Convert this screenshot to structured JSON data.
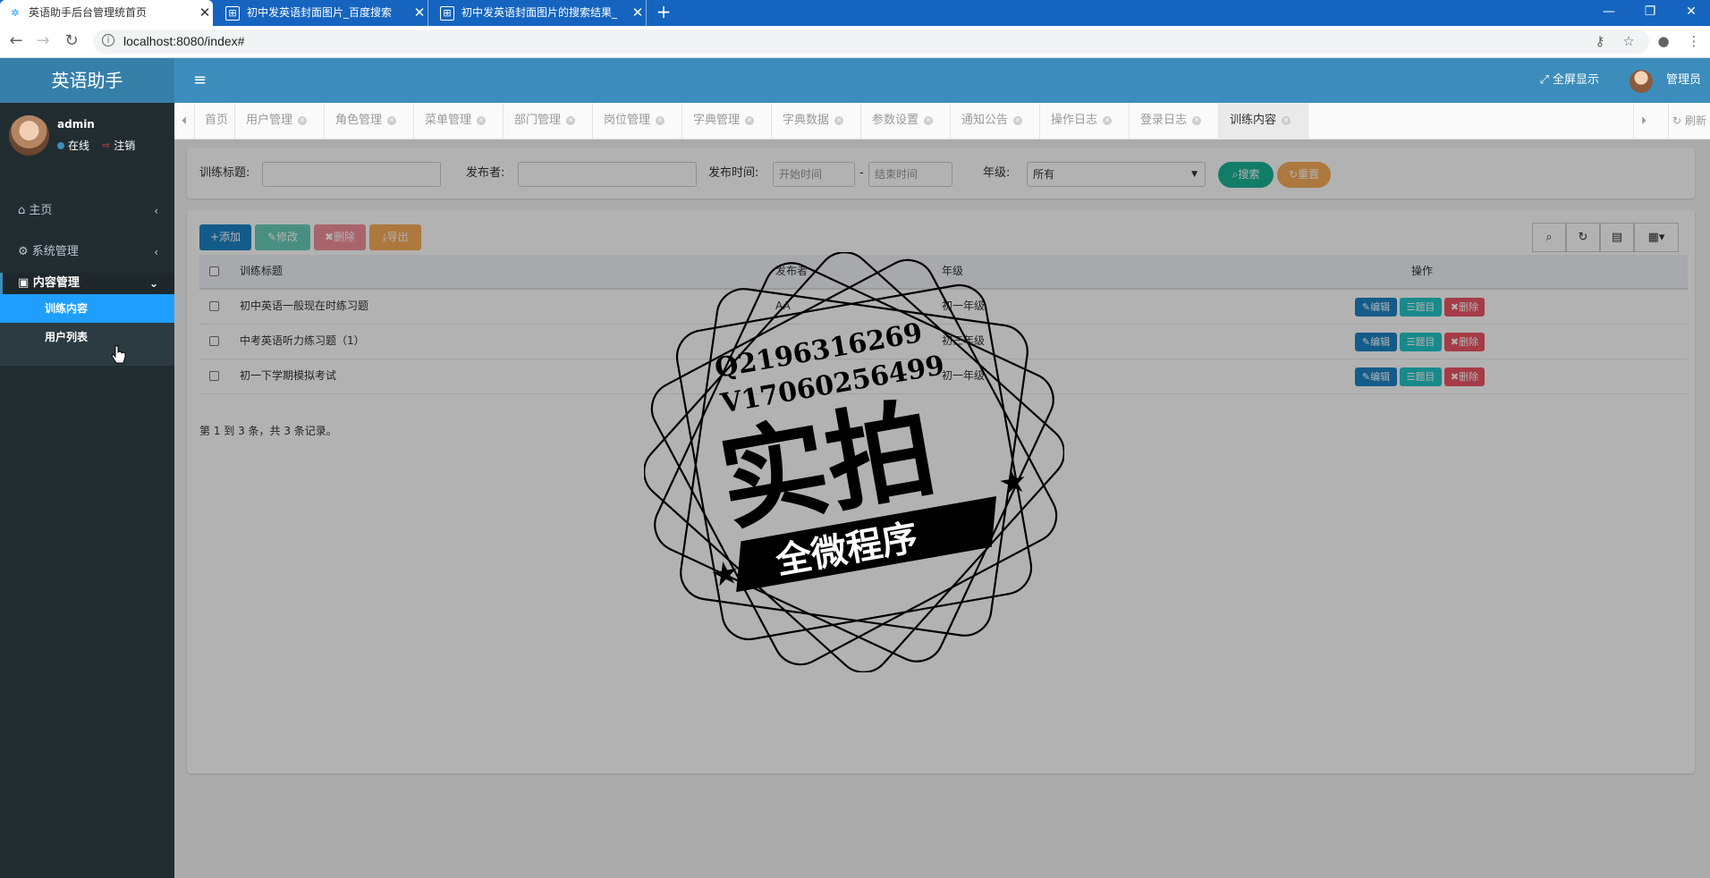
{
  "browser": {
    "tabs": [
      {
        "title": "英语助手后台管理统首页",
        "active": true
      },
      {
        "title": "初中发英语封面图片_百度搜索",
        "active": false
      },
      {
        "title": "初中发英语封面图片的搜索结果_",
        "active": false
      }
    ],
    "url": "localhost:8080/index#"
  },
  "header": {
    "logo": "英语助手",
    "toggle_icon": "≡",
    "fullscreen_label": "全屏显示",
    "user": "管理员"
  },
  "sidebar": {
    "user_name": "admin",
    "status_label": "在线",
    "logout_label": "注销",
    "items": [
      {
        "icon": "home-icon",
        "label": "主页"
      },
      {
        "icon": "gear-icon",
        "label": "系统管理"
      },
      {
        "icon": "bag-icon",
        "label": "内容管理"
      }
    ],
    "submenu": [
      {
        "label": "训练内容",
        "active": true
      },
      {
        "label": "用户列表",
        "active": false
      }
    ]
  },
  "content_tabs": [
    "首页",
    "用户管理",
    "角色管理",
    "菜单管理",
    "部门管理",
    "岗位管理",
    "字典管理",
    "字典数据",
    "参数设置",
    "通知公告",
    "操作日志",
    "登录日志",
    "训练内容"
  ],
  "refresh_label": "刷新",
  "search": {
    "title_label": "训练标题:",
    "publisher_label": "发布者:",
    "time_label": "发布时间:",
    "start_placeholder": "开始时间",
    "end_placeholder": "结束时间",
    "range_sep": "-",
    "grade_label": "年级:",
    "grade_value": "所有",
    "search_btn": "搜索",
    "reset_btn": "重置"
  },
  "toolbar": {
    "add": "添加",
    "edit": "修改",
    "delete": "删除",
    "export": "导出"
  },
  "table": {
    "headers": {
      "title": "训练标题",
      "publisher": "发布者",
      "grade": "年级",
      "actions": "操作"
    },
    "rows": [
      {
        "title": "初中英语一般现在时练习题",
        "publisher": "AA",
        "grade": "初一年级"
      },
      {
        "title": "中考英语听力练习题（1）",
        "publisher": "",
        "grade": "初三年级"
      },
      {
        "title": "初一下学期模拟考试",
        "publisher": "",
        "grade": "初一年级"
      }
    ],
    "row_actions": {
      "edit": "编辑",
      "questions": "题目",
      "delete": "删除"
    },
    "summary": "第 1 到 3 条，共 3 条记录。"
  },
  "watermark": {
    "line1": "Q2196316269",
    "line2": "V17060256499",
    "big": "实拍",
    "banner": "全微程序"
  },
  "colors": {
    "header": "#3c8dbc",
    "sidebar": "#222d32",
    "primary": "#1c84c6",
    "info": "#23c6c8",
    "danger": "#ed5565",
    "warning": "#f8ac59",
    "success": "#1ab394"
  }
}
